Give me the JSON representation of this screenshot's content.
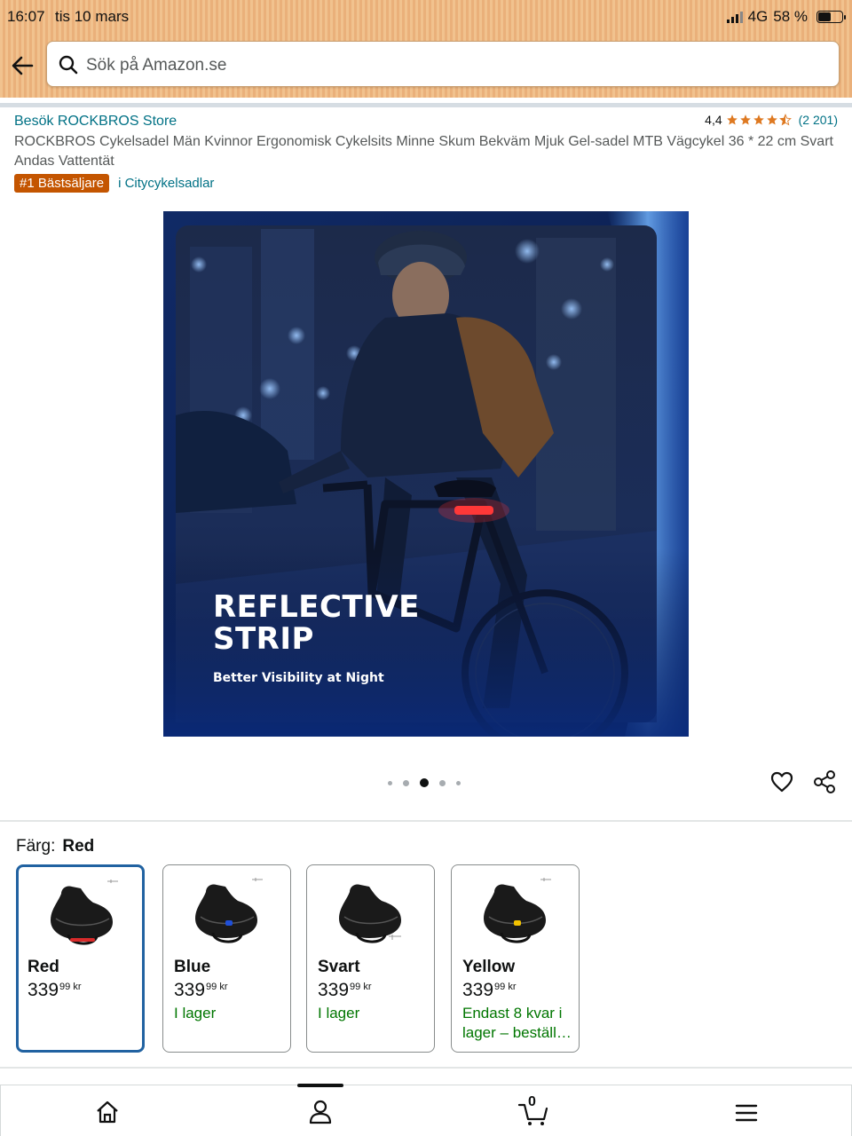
{
  "status_bar": {
    "time": "16:07",
    "date": "tis 10 mars",
    "network": "4G",
    "battery": "58 %",
    "battery_level": 0.58
  },
  "search": {
    "placeholder": "Sök på Amazon.se"
  },
  "product": {
    "store_link": "Besök ROCKBROS Store",
    "rating_value": "4,4",
    "rating_stars": 4.4,
    "rating_count": "(2 201)",
    "title": "ROCKBROS Cykelsadel Män Kvinnor Ergonomisk Cykelsits Minne Skum Bekväm Mjuk Gel-sadel MTB Vägcykel 36 * 22 cm Svart Andas Vattentät",
    "badge": "#1 Bästsäljare",
    "badge_category": "i Citycykelsadlar"
  },
  "hero_image": {
    "heading_line1": "REFLECTIVE",
    "heading_line2": "STRIP",
    "subheading": "Better Visibility at Night"
  },
  "carousel": {
    "total_dots": 5,
    "active_index": 2
  },
  "color_selector": {
    "label": "Färg:",
    "selected": "Red",
    "options": [
      {
        "name": "Red",
        "price_whole": "339",
        "price_fraction": "99",
        "currency": "kr",
        "stock": "",
        "accent": "#d92b2b"
      },
      {
        "name": "Blue",
        "price_whole": "339",
        "price_fraction": "99",
        "currency": "kr",
        "stock": "I lager",
        "accent": "#1f4fd8"
      },
      {
        "name": "Svart",
        "price_whole": "339",
        "price_fraction": "99",
        "currency": "kr",
        "stock": "I lager",
        "accent": "#3a3a3a"
      },
      {
        "name": "Yellow",
        "price_whole": "339",
        "price_fraction": "99",
        "currency": "kr",
        "stock": "Endast 8 kvar i lager – beställ…",
        "accent": "#f2c200"
      }
    ]
  },
  "bottom_nav": {
    "cart_count": "0",
    "items": [
      "home-icon",
      "account-icon",
      "cart-icon",
      "menu-icon"
    ]
  },
  "colors": {
    "link": "#007185",
    "badge": "#c45500",
    "stock_green": "#007600",
    "selected_border": "#2162a1",
    "star": "#de7921"
  }
}
